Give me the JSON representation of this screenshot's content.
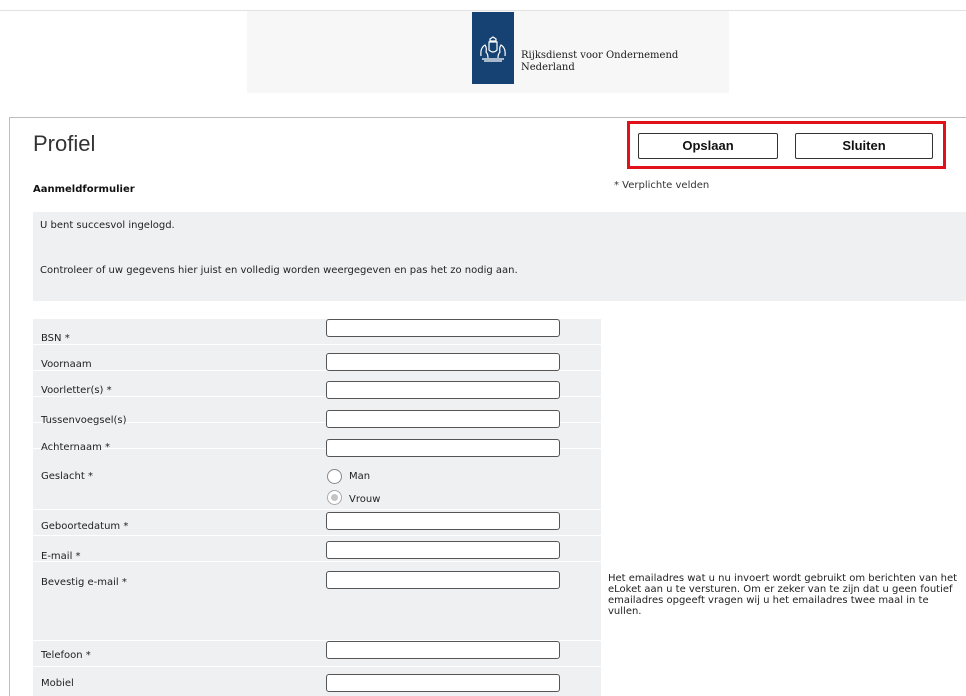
{
  "header": {
    "org_name_line1": "Rijksdienst voor Ondernemend",
    "org_name_line2": "Nederland"
  },
  "page": {
    "title": "Profiel",
    "form_heading": "Aanmeldformulier",
    "required_note": "* Verplichte velden"
  },
  "actions": {
    "save_label": "Opslaan",
    "close_label": "Sluiten"
  },
  "info": {
    "line1": "U bent succesvol ingelogd.",
    "line2": "Controleer of uw gegevens hier juist en volledig worden weergegeven en pas het zo nodig aan."
  },
  "form": {
    "bsn": {
      "label": "BSN *",
      "value": ""
    },
    "voornaam": {
      "label": "Voornaam",
      "value": ""
    },
    "voorletters": {
      "label": "Voorletter(s) *",
      "value": ""
    },
    "tussenvoegsel": {
      "label": "Tussenvoegsel(s)",
      "value": ""
    },
    "achternaam": {
      "label": "Achternaam *",
      "value": ""
    },
    "geslacht": {
      "label": "Geslacht *",
      "options": [
        "Man",
        "Vrouw"
      ],
      "selected": "Vrouw"
    },
    "geboortedatum": {
      "label": "Geboortedatum *",
      "value": ""
    },
    "email": {
      "label": "E-mail *",
      "value": ""
    },
    "bevestig_email": {
      "label": "Bevestig e-mail *",
      "value": "",
      "help": "Het emailadres wat u nu invoert wordt gebruikt om berichten van het eLoket aan u te versturen. Om er zeker van te zijn dat u geen foutief emailadres opgeeft vragen wij u het emailadres twee maal in te vullen."
    },
    "telefoon": {
      "label": "Telefoon *",
      "value": ""
    },
    "mobiel": {
      "label": "Mobiel",
      "value": ""
    }
  },
  "colors": {
    "brand": "#154273",
    "highlight": "#e1111a",
    "panel_bg": "#eef0f2"
  }
}
